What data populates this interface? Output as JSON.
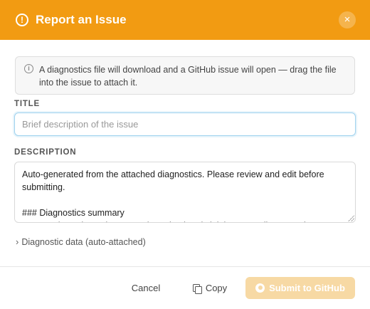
{
  "dialog": {
    "title": "Report an Issue",
    "close_icon": "close-icon",
    "accent_color": "#f29b12"
  },
  "info": {
    "text": "A diagnostics file will download and a GitHub issue will open — drag the file into the issue to attach it."
  },
  "fields": {
    "title_label": "TITLE",
    "title_placeholder": "Brief description of the issue",
    "title_value": "",
    "description_label": "DESCRIPTION",
    "description_value": "Auto-generated from the attached diagnostics. Please review and edit before submitting.\n\n### Diagnostics summary\n- Recent logs show: daemon stderr: simulated sink latency spike on Ratio"
  },
  "disclosure": {
    "label": "Diagnostic data (auto-attached)",
    "expanded": false
  },
  "footer": {
    "cancel_label": "Cancel",
    "copy_label": "Copy",
    "submit_label": "Submit to GitHub",
    "submit_enabled": false
  }
}
